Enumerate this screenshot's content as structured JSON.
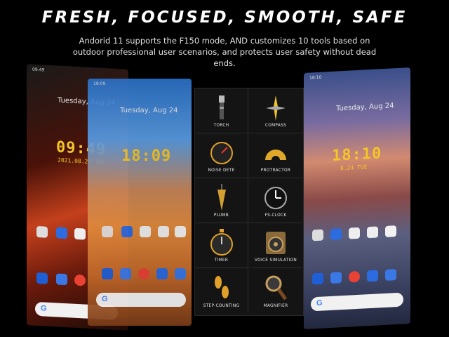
{
  "headline": "FRESH, FOCUSED, SMOOTH, SAFE",
  "subtitle": "Andorid 11 supports the F150 mode, AND customizes 10 tools based on outdoor professional user scenarios, and protects user safety without dead ends.",
  "left_phone": {
    "status_time": "09:49",
    "date": "Tuesday, Aug 24",
    "clock": "09:49",
    "date_line": "2021.08.24  TUE"
  },
  "middle_phone": {
    "status_time": "18:09",
    "date": "Tuesday, Aug 24",
    "clock": "18:09"
  },
  "right_phone": {
    "status_time": "18:10",
    "date": "Tuesday, Aug 24",
    "clock": "18:10",
    "date_line": "8.24  TUE"
  },
  "tools": [
    {
      "label": "TORCH",
      "icon": "torch-icon"
    },
    {
      "label": "COMPASS",
      "icon": "compass-icon"
    },
    {
      "label": "NOISE DETE",
      "icon": "noise-meter-icon"
    },
    {
      "label": "PROTRACTOR",
      "icon": "protractor-icon"
    },
    {
      "label": "PLUMB",
      "icon": "plumb-bob-icon"
    },
    {
      "label": "FS-CLOCK",
      "icon": "clock-icon"
    },
    {
      "label": "TIMER",
      "icon": "stopwatch-icon"
    },
    {
      "label": "VOICE SIMULATION",
      "icon": "speaker-icon"
    },
    {
      "label": "STEP-COUNTING",
      "icon": "footprints-icon"
    },
    {
      "label": "MAGNIFIER",
      "icon": "magnifier-icon"
    }
  ],
  "colors": {
    "clock_yellow": "#f3c52a",
    "panel_bg": "#141414",
    "background": "#000000"
  }
}
